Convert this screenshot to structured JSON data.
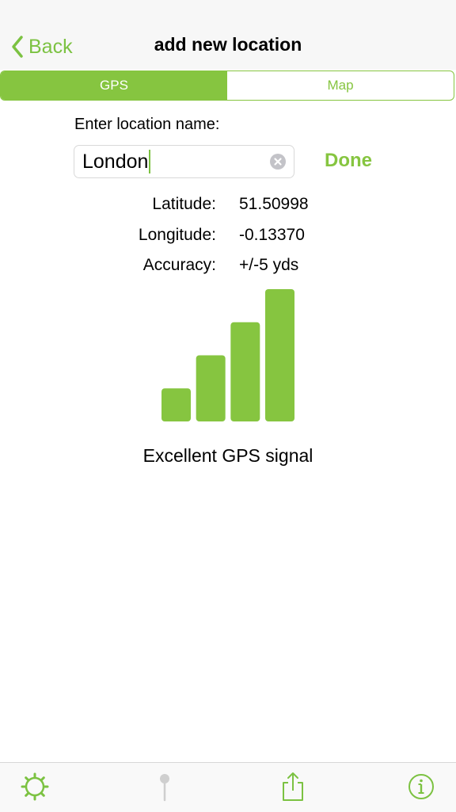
{
  "nav": {
    "back_label": "Back",
    "title": "add new location"
  },
  "segments": {
    "gps_label": "GPS",
    "map_label": "Map",
    "selected": "GPS"
  },
  "form": {
    "name_label": "Enter location name:",
    "name_value": "London",
    "done_label": "Done"
  },
  "coords": {
    "latitude_label": "Latitude:",
    "latitude_value": "51.50998",
    "longitude_label": "Longitude:",
    "longitude_value": "-0.13370",
    "accuracy_label": "Accuracy:",
    "accuracy_value": "+/-5 yds"
  },
  "signal": {
    "bars_total": 4,
    "bars_active": 4,
    "label": "Excellent GPS signal"
  },
  "tabbar": {
    "icons": [
      "gear-icon",
      "pin-icon",
      "share-icon",
      "info-icon"
    ]
  },
  "colors": {
    "accent": "#86c540",
    "accent_text": "#7cc242",
    "disabled": "#cfcfcf"
  }
}
